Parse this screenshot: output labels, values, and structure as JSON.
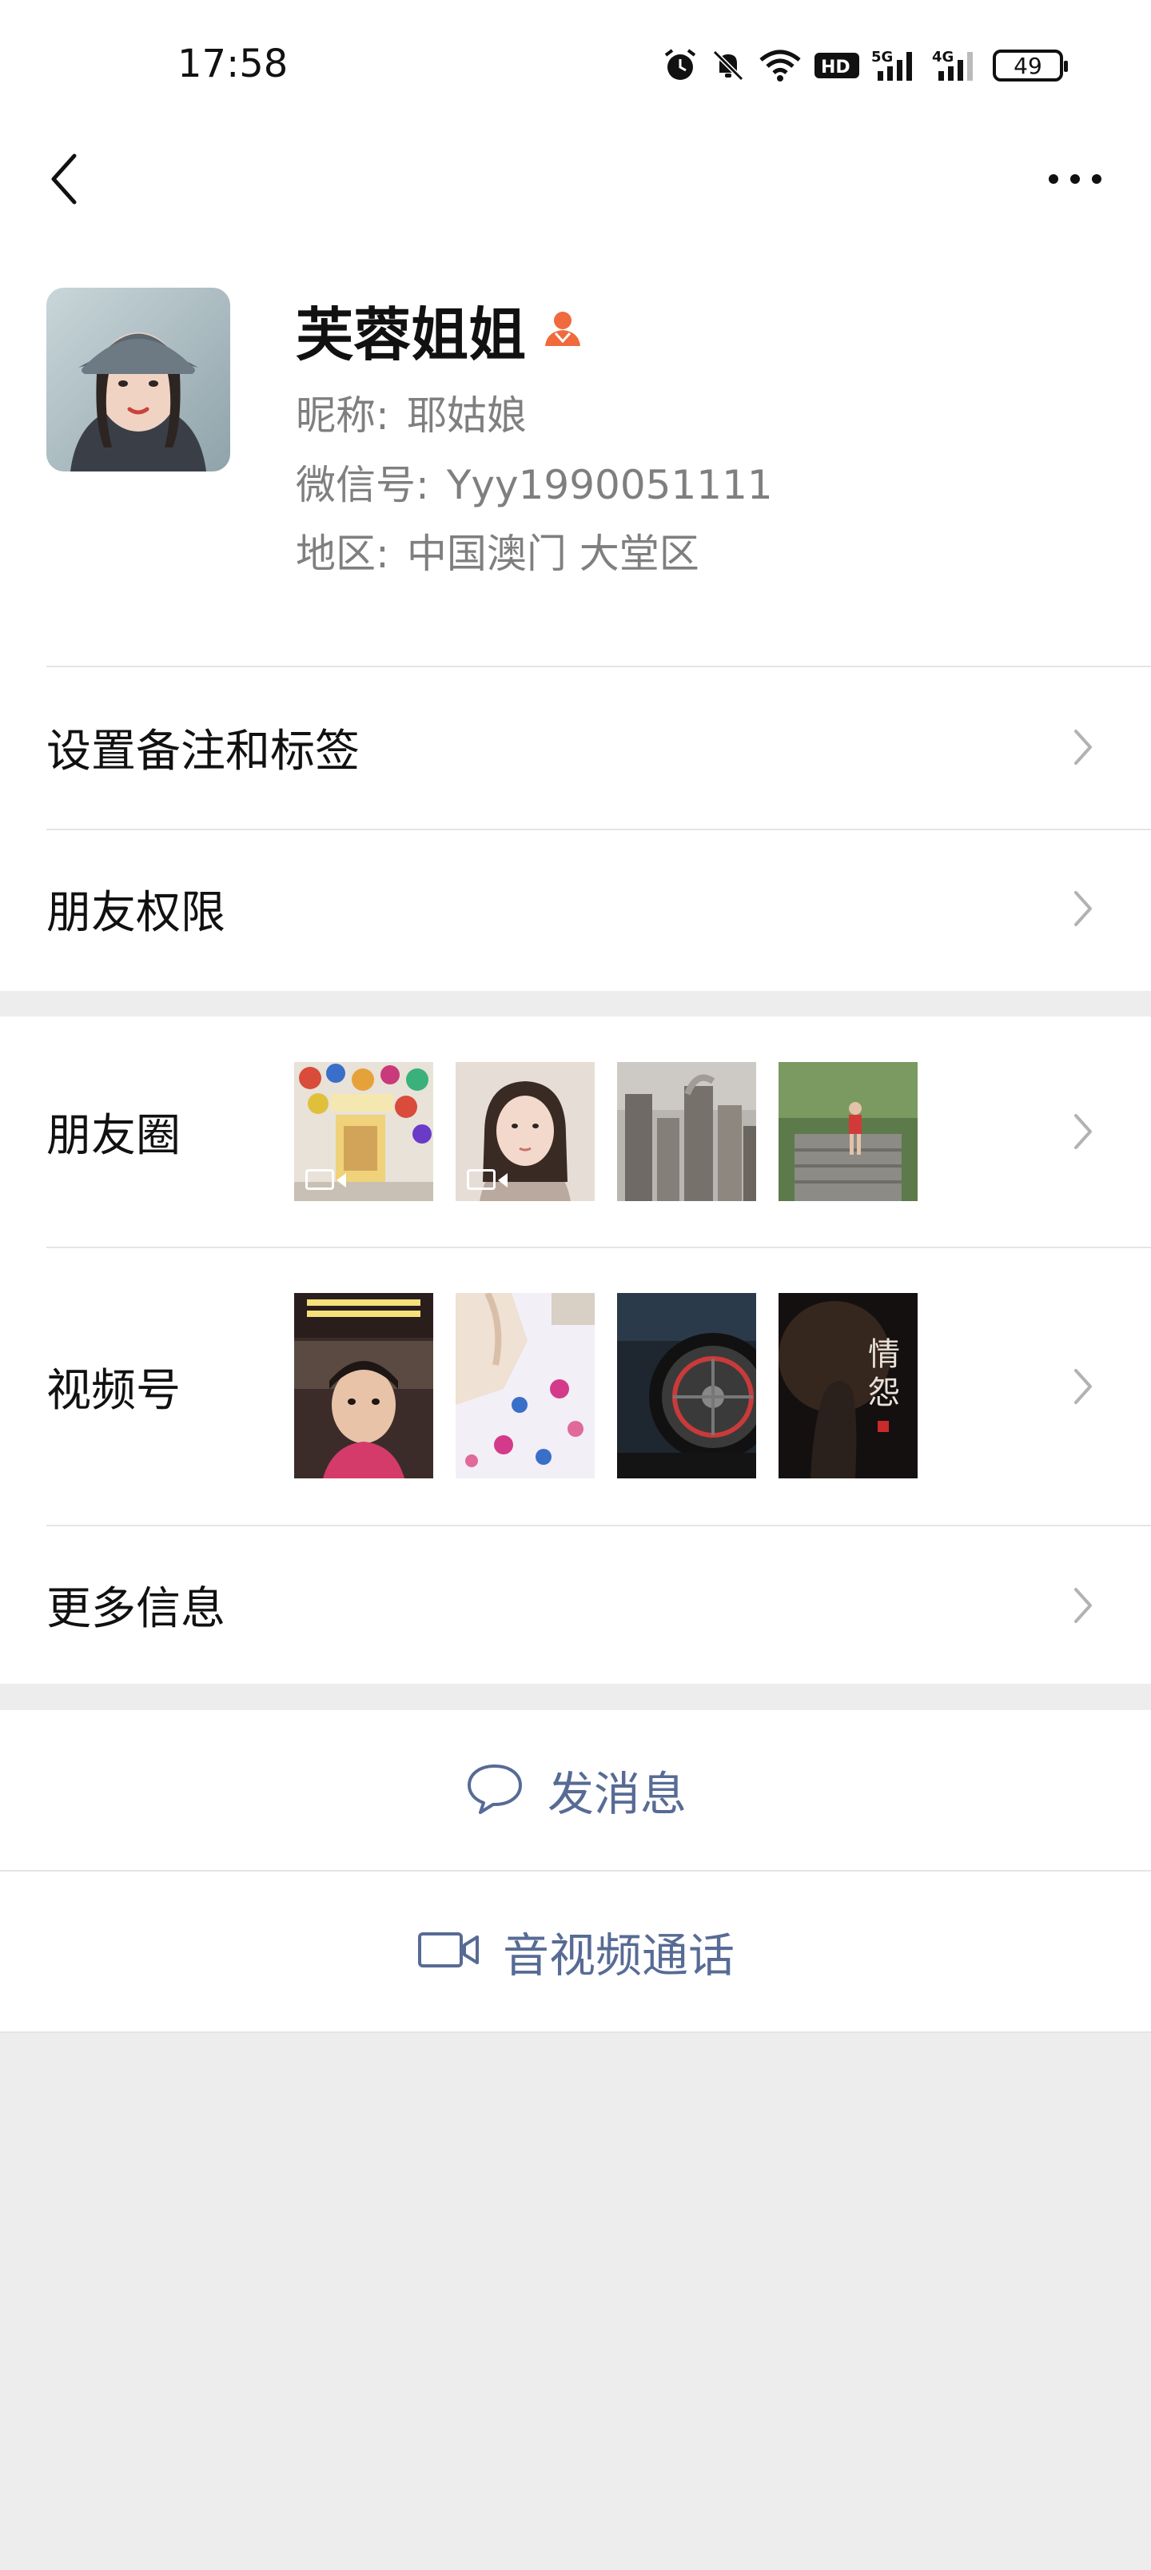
{
  "status_bar": {
    "time": "17:58",
    "battery": "49",
    "hd_label": "HD",
    "net5g": "5G",
    "net4g": "4G"
  },
  "profile": {
    "name": "芙蓉姐姐",
    "nickname_key": "昵称:",
    "nickname": "耶姑娘",
    "wechat_id_key": "微信号:",
    "wechat_id": "Yyy1990051111",
    "region_key": "地区:",
    "region": "中国澳门  大堂区",
    "gender_icon_color": "#f06a3d"
  },
  "rows": {
    "remark_tags": "设置备注和标签",
    "friend_permissions": "朋友权限",
    "moments": "朋友圈",
    "channels": "视频号",
    "more_info": "更多信息"
  },
  "actions": {
    "send_message": "发消息",
    "av_call": "音视频通话"
  },
  "moments_thumbs": [
    {
      "kind": "video",
      "icon": "poster-wall-thumb"
    },
    {
      "kind": "video",
      "icon": "selfie-thumb"
    },
    {
      "kind": "image",
      "icon": "buildings-thumb"
    },
    {
      "kind": "image",
      "icon": "person-steps-thumb"
    }
  ],
  "channels_thumbs": [
    {
      "icon": "child-classroom-thumb"
    },
    {
      "icon": "floral-cloth-thumb"
    },
    {
      "icon": "wheel-thumb"
    },
    {
      "icon": "dark-poster-thumb"
    }
  ],
  "colors": {
    "link": "#576b95",
    "background": "#ededed",
    "surface": "#ffffff"
  }
}
